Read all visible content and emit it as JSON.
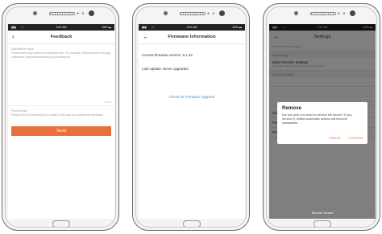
{
  "colors": {
    "accent": "#e8703a",
    "link": "#3b8ad9"
  },
  "icons": {
    "back_phone1": "chevron-left-icon",
    "back_arrow": "arrow-left-icon",
    "chevron": "chevron-right-icon"
  },
  "status": {
    "time": "9:41 AM",
    "battery": "46%"
  },
  "feedback": {
    "title": "Feedback",
    "describe_label": "Describe the issue",
    "describe_placeholder": "Please enter your problem or thoughts here. For example: which device is wrongly connected, what troubleshooting you already did",
    "counter": "0/1000",
    "email_label": "Phone/Email",
    "email_placeholder": "Please fill in the information of contact in the case you receive any feedback",
    "send": "Send"
  },
  "firmware": {
    "title": "Firmware Information",
    "current_version": "Current firmware version:  5.1.43",
    "last_update": "Last Update:  Never upgraded",
    "check_link": "Check for Firmware Upgrade"
  },
  "settings": {
    "title": "Settings",
    "device_name_sub": "DEVICE SPECIFIC NAME",
    "basic_header": "Basic Settings",
    "basic_title": "Basic Function Settings",
    "basic_sub": "Information related to the device and it's features",
    "advanced_header": "Advanced Settings",
    "share": "Share Device",
    "feedback": "Feedback",
    "firmware": "Firmware Information",
    "remove_device": "Remove Device",
    "dialog": {
      "title": "Remove",
      "message": "Are you sure you want to remove the device? If you remove it, related automatic actions will become unavailable.",
      "cancel": "CANCEL",
      "confirm": "CONFIRM"
    }
  }
}
